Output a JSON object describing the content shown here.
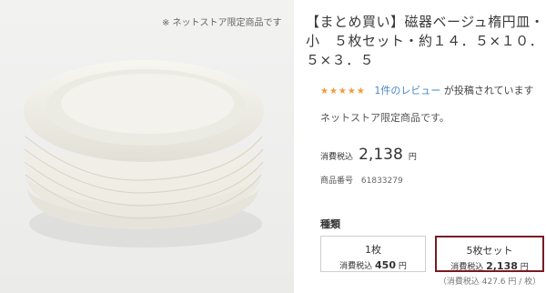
{
  "photo": {
    "note": "※ ネットストア限定商品です"
  },
  "product": {
    "title": "【まとめ買い】磁器ベージュ楕円皿・小　５枚セット・約１４．５×１０．５×３．５",
    "stars": "★★★★★",
    "review_link": "1件のレビュー",
    "review_suffix": "が投稿されています",
    "limited_note": "ネットストア限定商品です。",
    "tax_label": "消費税込",
    "price": "2,138",
    "yen": "円",
    "code_label": "商品番号",
    "code_value": "61833279"
  },
  "variants": {
    "heading": "種類",
    "items": [
      {
        "name": "1枚",
        "tax_label": "消費税込",
        "price": "450",
        "yen": "円"
      },
      {
        "name": "5枚セット",
        "tax_label": "消費税込",
        "price": "2,138",
        "yen": "円"
      }
    ],
    "per_item": "（消費税込 427.6 円 / 枚）"
  },
  "colors": {
    "selected_border": "#7b1a22",
    "stars": "#f19a3e",
    "link": "#4a86c5"
  }
}
